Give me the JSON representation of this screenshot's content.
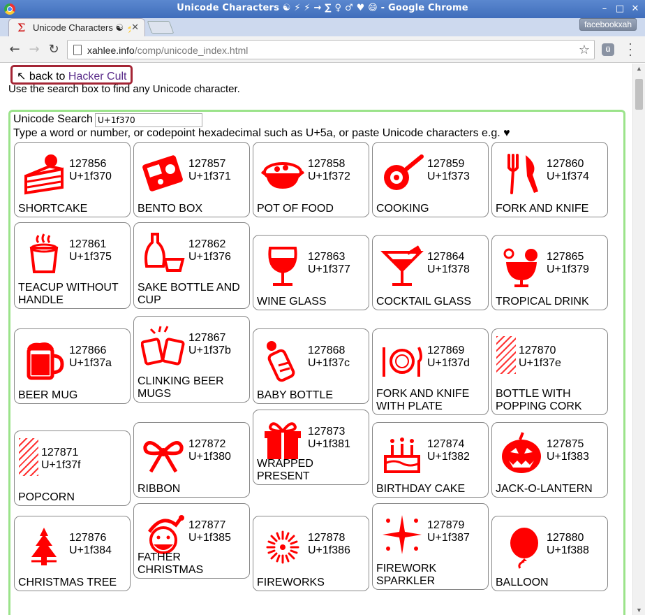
{
  "window": {
    "title": "Unicode Characters ☯ ⚡ ⚡ → ∑ ♀ ♂ ♥ 😄 - Google Chrome",
    "profile": "facebookxah"
  },
  "tab": {
    "favicon": "Σ",
    "label": "Unicode Characters ☯ ⚡"
  },
  "omnibox": {
    "host": "xahlee.info",
    "path": "/comp/unicode_index.html"
  },
  "extension": {
    "label": "ü"
  },
  "page": {
    "back_prefix": "↖ back to ",
    "back_link": "Hacker Cult",
    "intro": "Use the search box to find any Unicode character."
  },
  "search": {
    "label": "Unicode Search",
    "value": "U+1f370",
    "hint": "Type a word or number, or codepoint hexadecimal such as U+5a, or paste Unicode characters e.g. ♥"
  },
  "accent_colors": {
    "glyph": "#ff0000",
    "panel_border": "#9be38a",
    "back_box": "#a42535"
  },
  "cards": [
    {
      "dec": "127856",
      "hex": "U+1f370",
      "name": "SHORTCAKE",
      "icon": "shortcake-icon"
    },
    {
      "dec": "127857",
      "hex": "U+1f371",
      "name": "BENTO BOX",
      "icon": "bento-box-icon"
    },
    {
      "dec": "127858",
      "hex": "U+1f372",
      "name": "POT OF FOOD",
      "icon": "pot-of-food-icon"
    },
    {
      "dec": "127859",
      "hex": "U+1f373",
      "name": "COOKING",
      "icon": "cooking-icon"
    },
    {
      "dec": "127860",
      "hex": "U+1f374",
      "name": "FORK AND KNIFE",
      "icon": "fork-and-knife-icon"
    },
    {
      "dec": "127861",
      "hex": "U+1f375",
      "name": "TEACUP WITHOUT HANDLE",
      "icon": "teacup-icon"
    },
    {
      "dec": "127862",
      "hex": "U+1f376",
      "name": "SAKE BOTTLE AND CUP",
      "icon": "sake-icon"
    },
    {
      "dec": "127863",
      "hex": "U+1f377",
      "name": "WINE GLASS",
      "icon": "wine-glass-icon"
    },
    {
      "dec": "127864",
      "hex": "U+1f378",
      "name": "COCKTAIL GLASS",
      "icon": "cocktail-glass-icon"
    },
    {
      "dec": "127865",
      "hex": "U+1f379",
      "name": "TROPICAL DRINK",
      "icon": "tropical-drink-icon"
    },
    {
      "dec": "127866",
      "hex": "U+1f37a",
      "name": "BEER MUG",
      "icon": "beer-mug-icon"
    },
    {
      "dec": "127867",
      "hex": "U+1f37b",
      "name": "CLINKING BEER MUGS",
      "icon": "clinking-beer-mugs-icon"
    },
    {
      "dec": "127868",
      "hex": "U+1f37c",
      "name": "BABY BOTTLE",
      "icon": "baby-bottle-icon"
    },
    {
      "dec": "127869",
      "hex": "U+1f37d",
      "name": "FORK AND KNIFE WITH PLATE",
      "icon": "fork-knife-plate-icon"
    },
    {
      "dec": "127870",
      "hex": "U+1f37e",
      "name": "BOTTLE WITH POPPING CORK",
      "icon": "missing-glyph-icon"
    },
    {
      "dec": "127871",
      "hex": "U+1f37f",
      "name": "POPCORN",
      "icon": "missing-glyph-icon"
    },
    {
      "dec": "127872",
      "hex": "U+1f380",
      "name": "RIBBON",
      "icon": "ribbon-icon"
    },
    {
      "dec": "127873",
      "hex": "U+1f381",
      "name": "WRAPPED PRESENT",
      "icon": "wrapped-present-icon"
    },
    {
      "dec": "127874",
      "hex": "U+1f382",
      "name": "BIRTHDAY CAKE",
      "icon": "birthday-cake-icon"
    },
    {
      "dec": "127875",
      "hex": "U+1f383",
      "name": "JACK-O-LANTERN",
      "icon": "jack-o-lantern-icon"
    },
    {
      "dec": "127876",
      "hex": "U+1f384",
      "name": "CHRISTMAS TREE",
      "icon": "christmas-tree-icon"
    },
    {
      "dec": "127877",
      "hex": "U+1f385",
      "name": "FATHER CHRISTMAS",
      "icon": "father-christmas-icon"
    },
    {
      "dec": "127878",
      "hex": "U+1f386",
      "name": "FIREWORKS",
      "icon": "fireworks-icon"
    },
    {
      "dec": "127879",
      "hex": "U+1f387",
      "name": "FIREWORK SPARKLER",
      "icon": "firework-sparkler-icon"
    },
    {
      "dec": "127880",
      "hex": "U+1f388",
      "name": "BALLOON",
      "icon": "balloon-icon"
    }
  ]
}
